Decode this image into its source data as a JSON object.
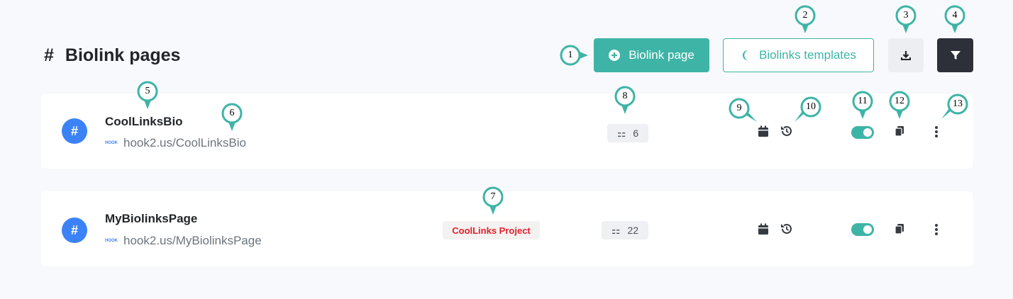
{
  "header": {
    "hash": "#",
    "title": "Biolink pages",
    "add_button": "Biolink page",
    "templates_button": "Biolinks templates"
  },
  "rows": [
    {
      "name": "CoolLinksBio",
      "url": "hook2.us/CoolLinksBio",
      "project": "",
      "stats": "6",
      "enabled": true
    },
    {
      "name": "MyBiolinksPage",
      "url": "hook2.us/MyBiolinksPage",
      "project": "CoolLinks Project",
      "stats": "22",
      "enabled": true
    }
  ],
  "url_icon_text": "HOOK",
  "callouts": [
    "1",
    "2",
    "3",
    "4",
    "5",
    "6",
    "7",
    "8",
    "9",
    "10",
    "11",
    "12",
    "13"
  ],
  "colors": {
    "accent": "#3eb4a7",
    "dark": "#2d3039",
    "avatar": "#3b82f6",
    "project": "#e4202a"
  },
  "icons": [
    "plus-circle-icon",
    "moon-icon",
    "download-icon",
    "filter-icon",
    "hash-icon",
    "chart-icon",
    "calendar-icon",
    "history-icon",
    "copy-icon",
    "kebab-icon"
  ]
}
